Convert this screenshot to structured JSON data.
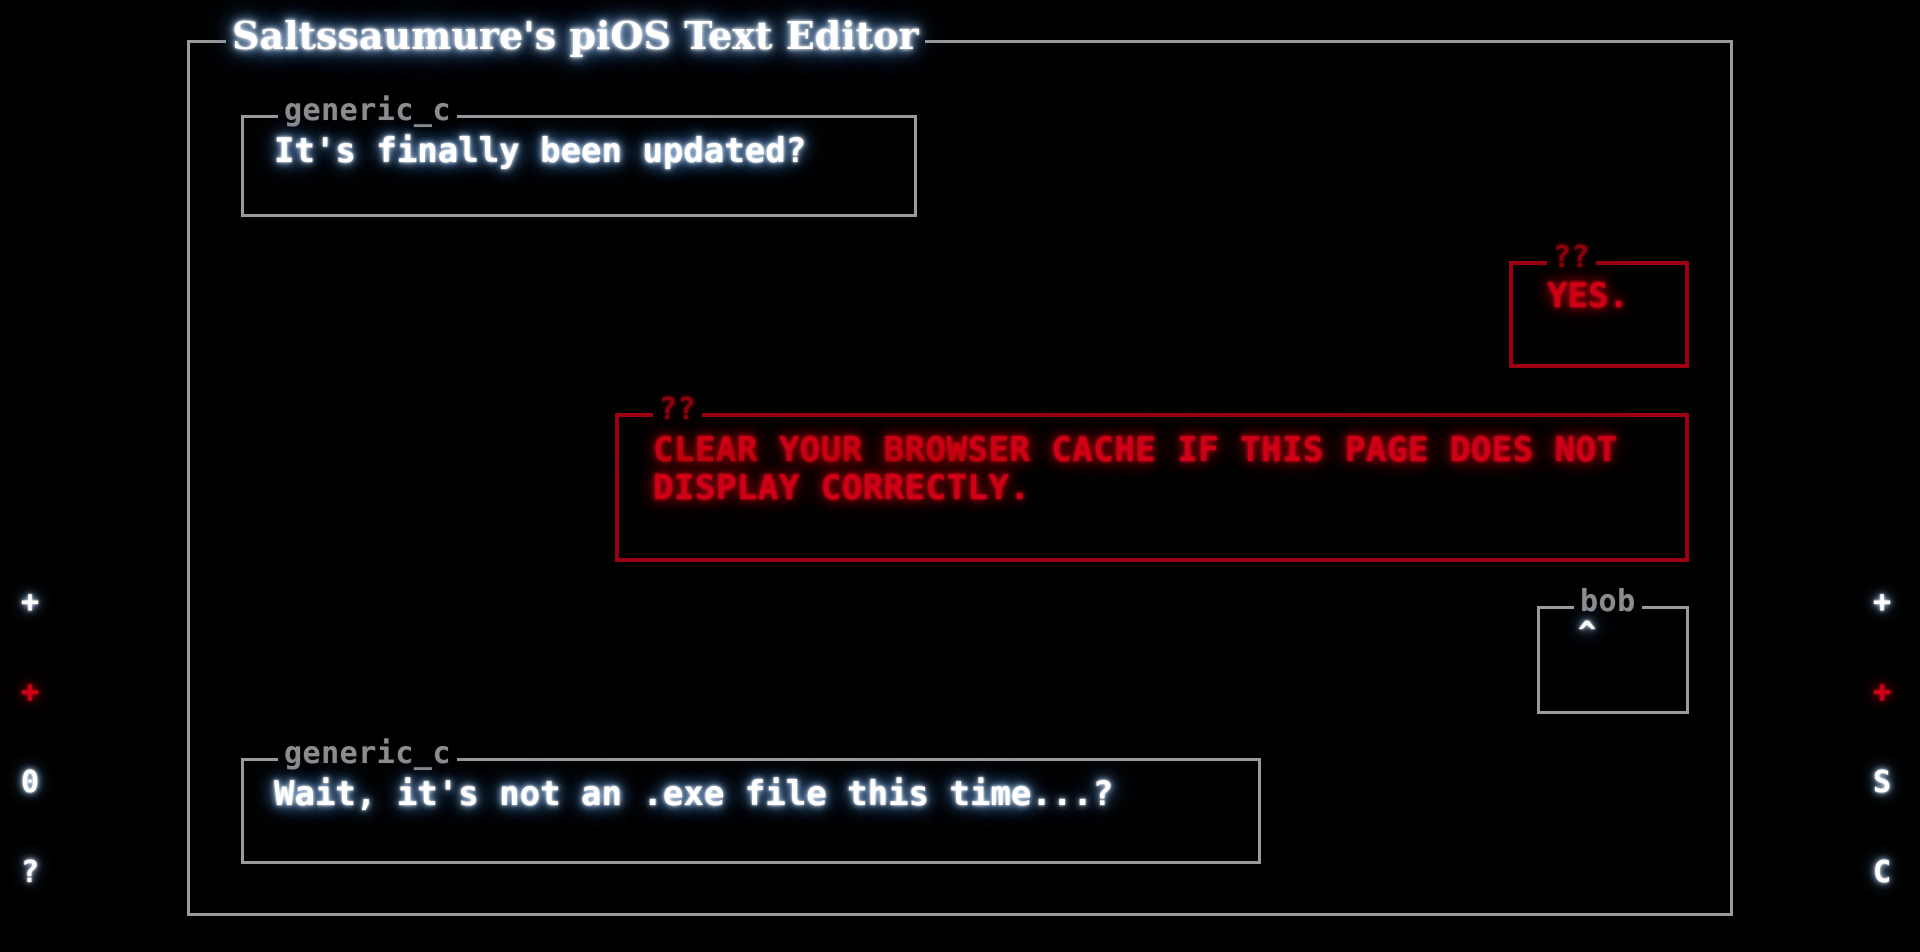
{
  "window": {
    "title": "Saltssaumure's piOS Text Editor",
    "background_color": "#000000",
    "frame_color": "#9a9a9a"
  },
  "theme": {
    "white_text": "#ffffff",
    "white_glow": "#74aae8",
    "gray_legend": "#8d8d8d",
    "red_text": "#cf0015",
    "red_border": "#9d0012",
    "red_legend": "#8e0010"
  },
  "dialogs": [
    {
      "id": "generic-top",
      "speaker": "generic_c",
      "text": "It's finally been updated?",
      "style": "white"
    },
    {
      "id": "yes",
      "speaker": "??",
      "text": "YES.",
      "style": "red"
    },
    {
      "id": "warning",
      "speaker": "??",
      "text": "CLEAR YOUR BROWSER CACHE IF THIS PAGE DOES NOT DISPLAY CORRECTLY.",
      "style": "red"
    },
    {
      "id": "bob",
      "speaker": "bob",
      "text": "^",
      "style": "white"
    },
    {
      "id": "generic-bottom",
      "speaker": "generic_c",
      "text": "Wait, it's not an .exe file this time...?",
      "style": "white"
    }
  ],
  "markers": {
    "left": [
      {
        "glyph": "+",
        "color": "white"
      },
      {
        "glyph": "+",
        "color": "red"
      },
      {
        "glyph": "0",
        "color": "white"
      },
      {
        "glyph": "?",
        "color": "white"
      }
    ],
    "right": [
      {
        "glyph": "+",
        "color": "white"
      },
      {
        "glyph": "+",
        "color": "red"
      },
      {
        "glyph": "S",
        "color": "white"
      },
      {
        "glyph": "C",
        "color": "white"
      }
    ]
  }
}
